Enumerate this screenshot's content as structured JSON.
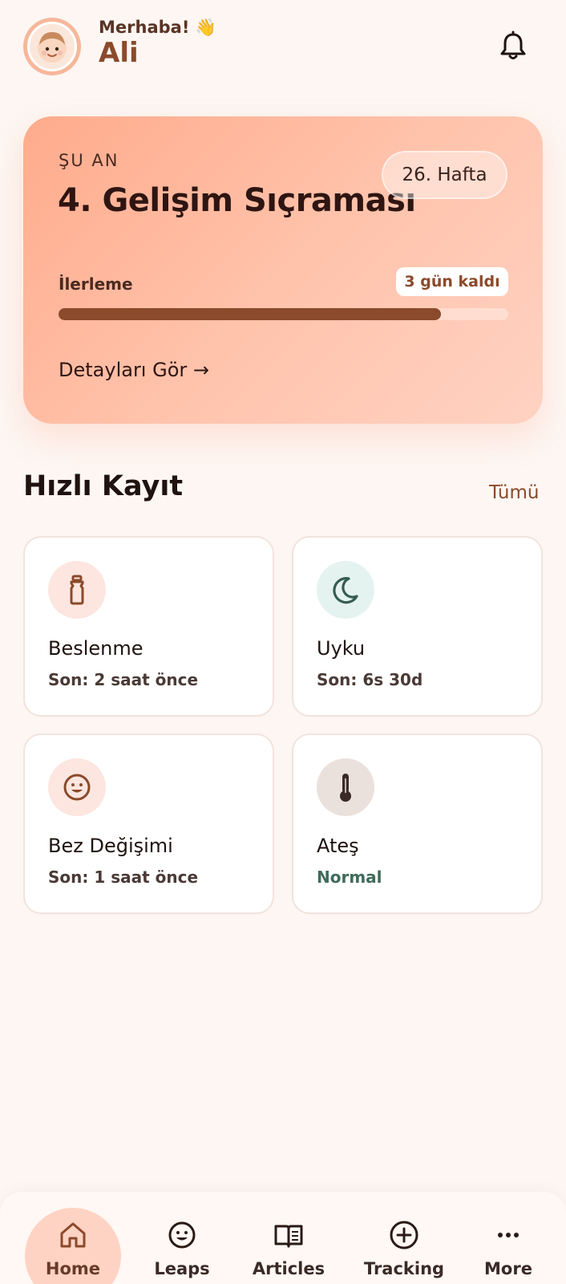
{
  "header": {
    "greeting": "Merhaba! 👋",
    "name": "Ali"
  },
  "hero": {
    "kicker": "ŞU AN",
    "title": "4. Gelişim Sıçraması",
    "week": "26. Hafta",
    "progress_label": "İlerleme",
    "days_left": "3 gün kaldı",
    "progress": 0.85,
    "details": "Detayları Gör →"
  },
  "quick_log": {
    "title": "Hızlı Kayıt",
    "see_all": "Tümü",
    "cards": [
      {
        "title": "Beslenme",
        "sub": "Son: 2 saat önce",
        "icon": "bottle-icon"
      },
      {
        "title": "Uyku",
        "sub": "Son: 6s 30d",
        "icon": "moon-icon"
      },
      {
        "title": "Bez Değişimi",
        "sub": "Son: 1 saat önce",
        "icon": "smiley-icon"
      },
      {
        "title": "Ateş",
        "sub": "Normal",
        "icon": "thermometer-icon"
      }
    ]
  },
  "nav": {
    "items": [
      {
        "label": "Home",
        "icon": "home-icon",
        "active": true
      },
      {
        "label": "Leaps",
        "icon": "smiley-icon"
      },
      {
        "label": "Articles",
        "icon": "book-icon"
      },
      {
        "label": "Tracking",
        "icon": "plus-circle-icon"
      },
      {
        "label": "More",
        "icon": "more-icon"
      }
    ]
  },
  "colors": {
    "accent": "#8b4a2b",
    "background": "#fdf6f2",
    "hero_gradient_start": "#ffab8c",
    "hero_gradient_end": "#ffd2c2"
  }
}
